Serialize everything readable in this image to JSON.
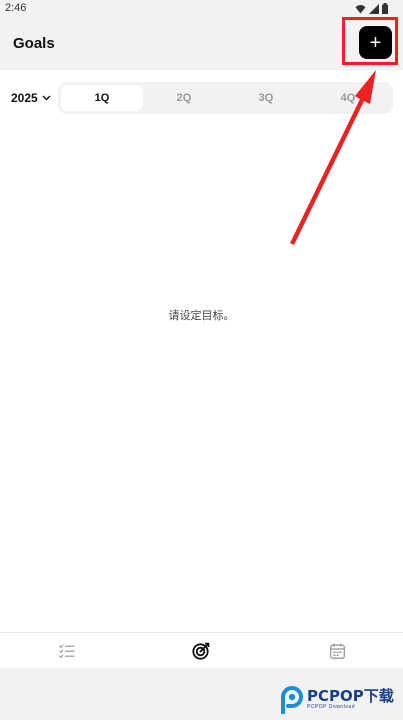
{
  "status_bar": {
    "time": "2:46",
    "icons": [
      "wifi-icon",
      "signal-icon",
      "battery-icon"
    ]
  },
  "header": {
    "title": "Goals",
    "add_button_label": "+"
  },
  "filter": {
    "year": "2025",
    "quarters": [
      {
        "label": "1Q",
        "selected": true
      },
      {
        "label": "2Q",
        "selected": false
      },
      {
        "label": "3Q",
        "selected": false
      },
      {
        "label": "4Q",
        "selected": false
      }
    ]
  },
  "main": {
    "empty_message": "请设定目标。"
  },
  "bottom_nav": {
    "items": [
      {
        "icon": "checklist-icon",
        "active": false
      },
      {
        "icon": "target-icon",
        "active": true
      },
      {
        "icon": "calendar-icon",
        "active": false
      }
    ]
  },
  "watermark": {
    "text": "PCPOP下载",
    "subtext": "PCPOP Download"
  },
  "colors": {
    "annotation": "#ef2020",
    "inactive_icon": "#9a9a9a",
    "active_icon": "#111111",
    "watermark": "#1a3f8a"
  }
}
